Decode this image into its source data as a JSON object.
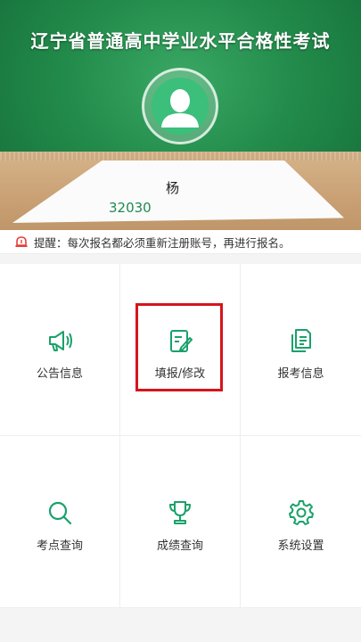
{
  "header": {
    "title": "辽宁省普通高中学业水平合格性考试",
    "name_on_paper": "杨",
    "id_on_paper": "32030"
  },
  "notice": {
    "text": "提醒：每次报名都必须重新注册账号，再进行报名。"
  },
  "menu": {
    "items": [
      {
        "label": "公告信息",
        "icon": "megaphone-icon"
      },
      {
        "label": "填报/修改",
        "icon": "edit-icon"
      },
      {
        "label": "报考信息",
        "icon": "documents-icon"
      },
      {
        "label": "考点查询",
        "icon": "search-icon"
      },
      {
        "label": "成绩查询",
        "icon": "trophy-icon"
      },
      {
        "label": "系统设置",
        "icon": "gear-icon"
      }
    ]
  },
  "colors": {
    "accent": "#1aa16a",
    "header_green": "#228b4b",
    "highlight_red": "#d6141c",
    "notice_icon": "#e6413c"
  }
}
